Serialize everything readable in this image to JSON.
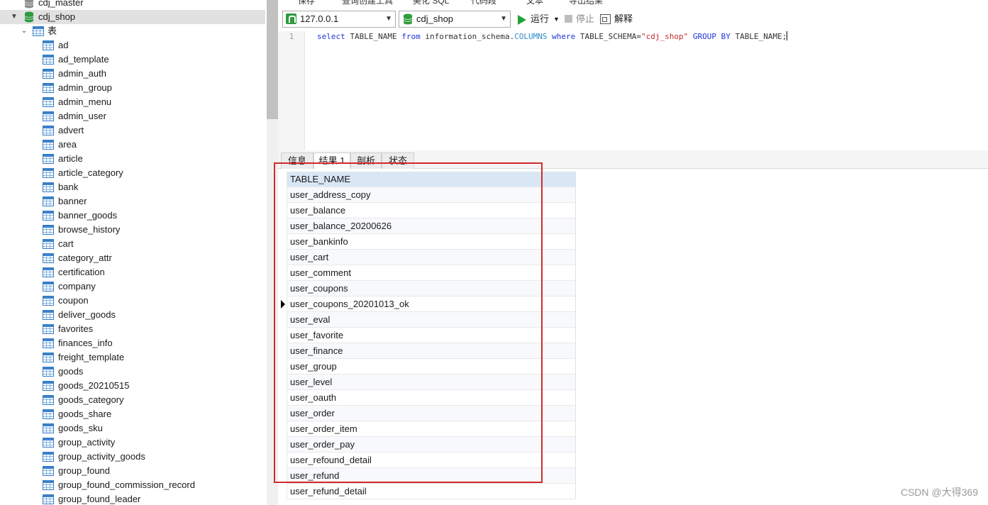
{
  "tree": {
    "items": [
      {
        "label": "cdj_master",
        "type": "db",
        "level": 0
      },
      {
        "label": "cdj_shop",
        "type": "db-open",
        "level": 0
      },
      {
        "label": "表",
        "type": "folder",
        "level": 1
      },
      {
        "label": "ad",
        "type": "table",
        "level": 2
      },
      {
        "label": "ad_template",
        "type": "table",
        "level": 2
      },
      {
        "label": "admin_auth",
        "type": "table",
        "level": 2
      },
      {
        "label": "admin_group",
        "type": "table",
        "level": 2
      },
      {
        "label": "admin_menu",
        "type": "table",
        "level": 2
      },
      {
        "label": "admin_user",
        "type": "table",
        "level": 2
      },
      {
        "label": "advert",
        "type": "table",
        "level": 2
      },
      {
        "label": "area",
        "type": "table",
        "level": 2
      },
      {
        "label": "article",
        "type": "table",
        "level": 2
      },
      {
        "label": "article_category",
        "type": "table",
        "level": 2
      },
      {
        "label": "bank",
        "type": "table",
        "level": 2
      },
      {
        "label": "banner",
        "type": "table",
        "level": 2
      },
      {
        "label": "banner_goods",
        "type": "table",
        "level": 2
      },
      {
        "label": "browse_history",
        "type": "table",
        "level": 2
      },
      {
        "label": "cart",
        "type": "table",
        "level": 2
      },
      {
        "label": "category_attr",
        "type": "table",
        "level": 2
      },
      {
        "label": "certification",
        "type": "table",
        "level": 2
      },
      {
        "label": "company",
        "type": "table",
        "level": 2
      },
      {
        "label": "coupon",
        "type": "table",
        "level": 2
      },
      {
        "label": "deliver_goods",
        "type": "table",
        "level": 2
      },
      {
        "label": "favorites",
        "type": "table",
        "level": 2
      },
      {
        "label": "finances_info",
        "type": "table",
        "level": 2
      },
      {
        "label": "freight_template",
        "type": "table",
        "level": 2
      },
      {
        "label": "goods",
        "type": "table",
        "level": 2
      },
      {
        "label": "goods_20210515",
        "type": "table",
        "level": 2
      },
      {
        "label": "goods_category",
        "type": "table",
        "level": 2
      },
      {
        "label": "goods_share",
        "type": "table",
        "level": 2
      },
      {
        "label": "goods_sku",
        "type": "table",
        "level": 2
      },
      {
        "label": "group_activity",
        "type": "table",
        "level": 2
      },
      {
        "label": "group_activity_goods",
        "type": "table",
        "level": 2
      },
      {
        "label": "group_found",
        "type": "table",
        "level": 2
      },
      {
        "label": "group_found_commission_record",
        "type": "table",
        "level": 2
      },
      {
        "label": "group_found_leader",
        "type": "table",
        "level": 2
      }
    ],
    "selected_index": 1
  },
  "toolbar": {
    "connection": "127.0.0.1",
    "database": "cdj_shop",
    "run_label": "运行",
    "stop_label": "停止",
    "explain_label": "解释",
    "top_partial": [
      "保存",
      "查询创建工具",
      "美化 SQL",
      "代码段",
      "文本",
      "导出结果"
    ]
  },
  "editor": {
    "line_number": "1",
    "sql": {
      "kw_select": "select",
      "t1": " TABLE_NAME ",
      "kw_from": "from",
      "t2": " information_schema.",
      "fn_columns": "COLUMNS",
      "t3": " ",
      "kw_where": "where",
      "t4": " TABLE_SCHEMA=",
      "str_val": "\"cdj_shop\"",
      "t5": " ",
      "kw_group": "GROUP BY",
      "t6": " TABLE_NAME;"
    }
  },
  "result_tabs": [
    "信息",
    "结果 1",
    "剖析",
    "状态"
  ],
  "active_tab": "结果 1",
  "grid": {
    "column": "TABLE_NAME",
    "rows": [
      "user_address_copy",
      "user_balance",
      "user_balance_20200626",
      "user_bankinfo",
      "user_cart",
      "user_comment",
      "user_coupons",
      "user_coupons_20201013_ok",
      "user_eval",
      "user_favorite",
      "user_finance",
      "user_group",
      "user_level",
      "user_oauth",
      "user_order",
      "user_order_item",
      "user_order_pay",
      "user_refound_detail",
      "user_refund",
      "user_refund_detail"
    ],
    "current_row_index": 7
  },
  "watermark": "CSDN @大得369",
  "colors": {
    "highlight_box": "#d32a2a",
    "header_bg": "#d9e7f5",
    "db_icon": "#2e9b3e",
    "table_icon": "#3a7fc6",
    "run_icon": "#21a335"
  }
}
